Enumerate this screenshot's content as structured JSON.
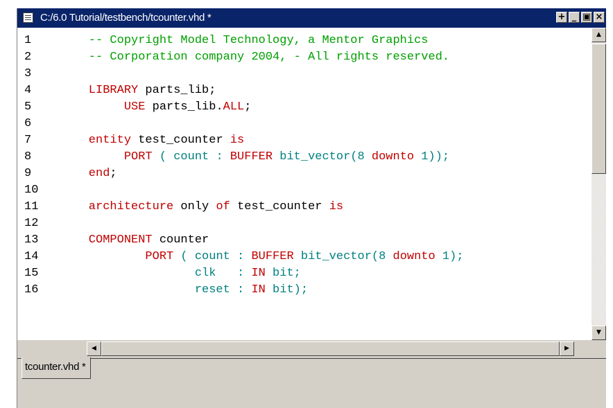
{
  "window": {
    "title": "C:/6.0 Tutorial/testbench/tcounter.vhd *"
  },
  "titlebar_buttons": [
    "+",
    "_",
    "▣",
    "×"
  ],
  "tab": {
    "label": "tcounter.vhd *"
  },
  "code_lines": [
    {
      "n": "1",
      "tokens": [
        {
          "t": "    -- Copyright Model Technology, a Mentor Graphics",
          "c": "comment"
        }
      ]
    },
    {
      "n": "2",
      "tokens": [
        {
          "t": "    -- Corporation company 2004, - All rights reserved.",
          "c": "comment"
        }
      ]
    },
    {
      "n": "3",
      "tokens": []
    },
    {
      "n": "4",
      "tokens": [
        {
          "t": "    LIBRARY",
          "c": "kw"
        },
        {
          "t": " parts_lib;",
          "c": "plain"
        }
      ]
    },
    {
      "n": "5",
      "tokens": [
        {
          "t": "         USE",
          "c": "kw"
        },
        {
          "t": " parts_lib.",
          "c": "plain"
        },
        {
          "t": "ALL",
          "c": "kw"
        },
        {
          "t": ";",
          "c": "plain"
        }
      ]
    },
    {
      "n": "6",
      "tokens": []
    },
    {
      "n": "7",
      "tokens": [
        {
          "t": "    entity",
          "c": "kw"
        },
        {
          "t": " test_counter ",
          "c": "plain"
        },
        {
          "t": "is",
          "c": "kw"
        }
      ]
    },
    {
      "n": "8",
      "tokens": [
        {
          "t": "         PORT",
          "c": "kw"
        },
        {
          "t": " ( count : ",
          "c": "type"
        },
        {
          "t": "BUFFER",
          "c": "kw"
        },
        {
          "t": " bit_vector(8 ",
          "c": "type"
        },
        {
          "t": "downto",
          "c": "kw"
        },
        {
          "t": " 1));",
          "c": "type"
        }
      ]
    },
    {
      "n": "9",
      "tokens": [
        {
          "t": "    end",
          "c": "kw"
        },
        {
          "t": ";",
          "c": "plain"
        }
      ]
    },
    {
      "n": "10",
      "tokens": []
    },
    {
      "n": "11",
      "tokens": [
        {
          "t": "    architecture",
          "c": "kw"
        },
        {
          "t": " only ",
          "c": "plain"
        },
        {
          "t": "of",
          "c": "kw"
        },
        {
          "t": " test_counter ",
          "c": "plain"
        },
        {
          "t": "is",
          "c": "kw"
        }
      ]
    },
    {
      "n": "12",
      "tokens": []
    },
    {
      "n": "13",
      "tokens": [
        {
          "t": "    COMPONENT",
          "c": "kw"
        },
        {
          "t": " counter",
          "c": "plain"
        }
      ]
    },
    {
      "n": "14",
      "tokens": [
        {
          "t": "            PORT",
          "c": "kw"
        },
        {
          "t": " ( count : ",
          "c": "type"
        },
        {
          "t": "BUFFER",
          "c": "kw"
        },
        {
          "t": " bit_vector(8 ",
          "c": "type"
        },
        {
          "t": "downto",
          "c": "kw"
        },
        {
          "t": " 1);",
          "c": "type"
        }
      ]
    },
    {
      "n": "15",
      "tokens": [
        {
          "t": "                   clk   : ",
          "c": "type"
        },
        {
          "t": "IN",
          "c": "kw"
        },
        {
          "t": " bit;",
          "c": "type"
        }
      ]
    },
    {
      "n": "16",
      "tokens": [
        {
          "t": "                   reset : ",
          "c": "type"
        },
        {
          "t": "IN",
          "c": "kw"
        },
        {
          "t": " bit);",
          "c": "type"
        }
      ]
    }
  ],
  "colors": {
    "comment": "#00a000",
    "keyword": "#c00000",
    "identifier": "#008080",
    "titlebar": "#0a246a"
  }
}
